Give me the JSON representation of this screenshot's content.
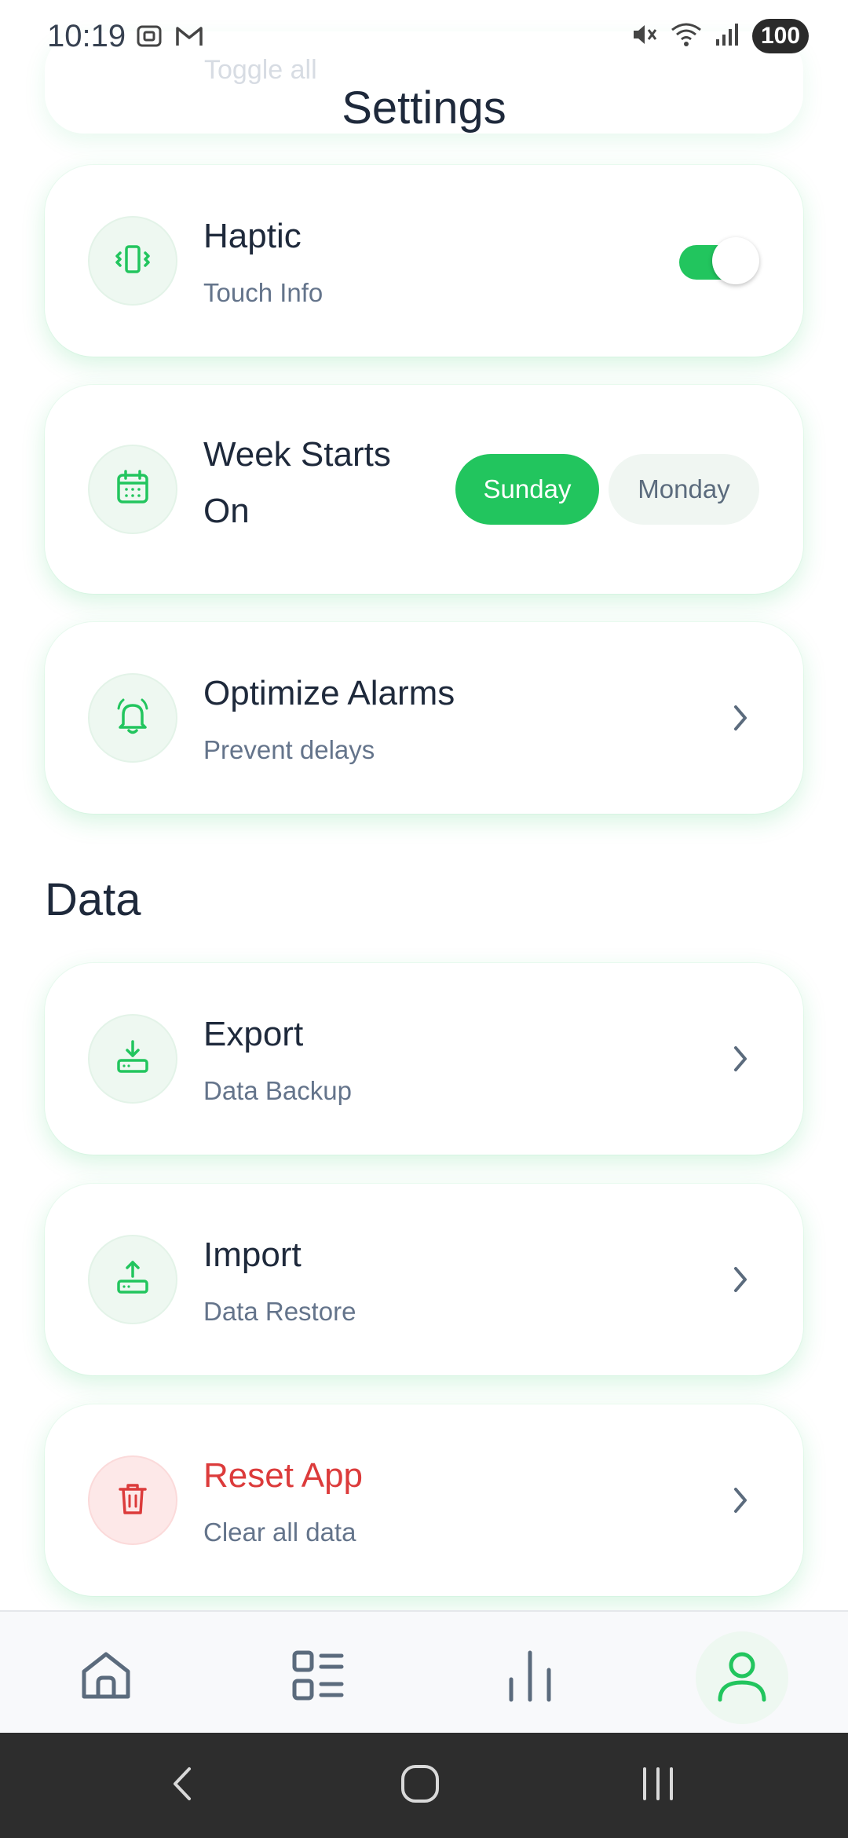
{
  "status": {
    "time": "10:19",
    "battery": "100",
    "icons": [
      "screenshot-icon",
      "gmail-icon",
      "mute-icon",
      "wifi-icon",
      "signal-icon"
    ]
  },
  "header": {
    "ghost_label": "Toggle all",
    "title": "Settings"
  },
  "haptic": {
    "title": "Haptic",
    "subtitle": "Touch Info",
    "enabled": true
  },
  "week_start": {
    "title_line1": "Week Starts",
    "title_line2": "On",
    "options": [
      "Sunday",
      "Monday"
    ],
    "selected": "Sunday"
  },
  "alarms": {
    "title": "Optimize Alarms",
    "subtitle": "Prevent delays"
  },
  "data_section": {
    "title": "Data",
    "export": {
      "title": "Export",
      "subtitle": "Data Backup"
    },
    "import": {
      "title": "Import",
      "subtitle": "Data Restore"
    },
    "reset": {
      "title": "Reset App",
      "subtitle": "Clear all data"
    }
  },
  "bottom_nav": {
    "items": [
      "home-icon",
      "list-icon",
      "chart-icon",
      "profile-icon"
    ],
    "active": "profile-icon"
  },
  "colors": {
    "accent": "#22c55e",
    "danger": "#dc3b3b",
    "text": "#1e293b",
    "muted": "#64748b"
  }
}
